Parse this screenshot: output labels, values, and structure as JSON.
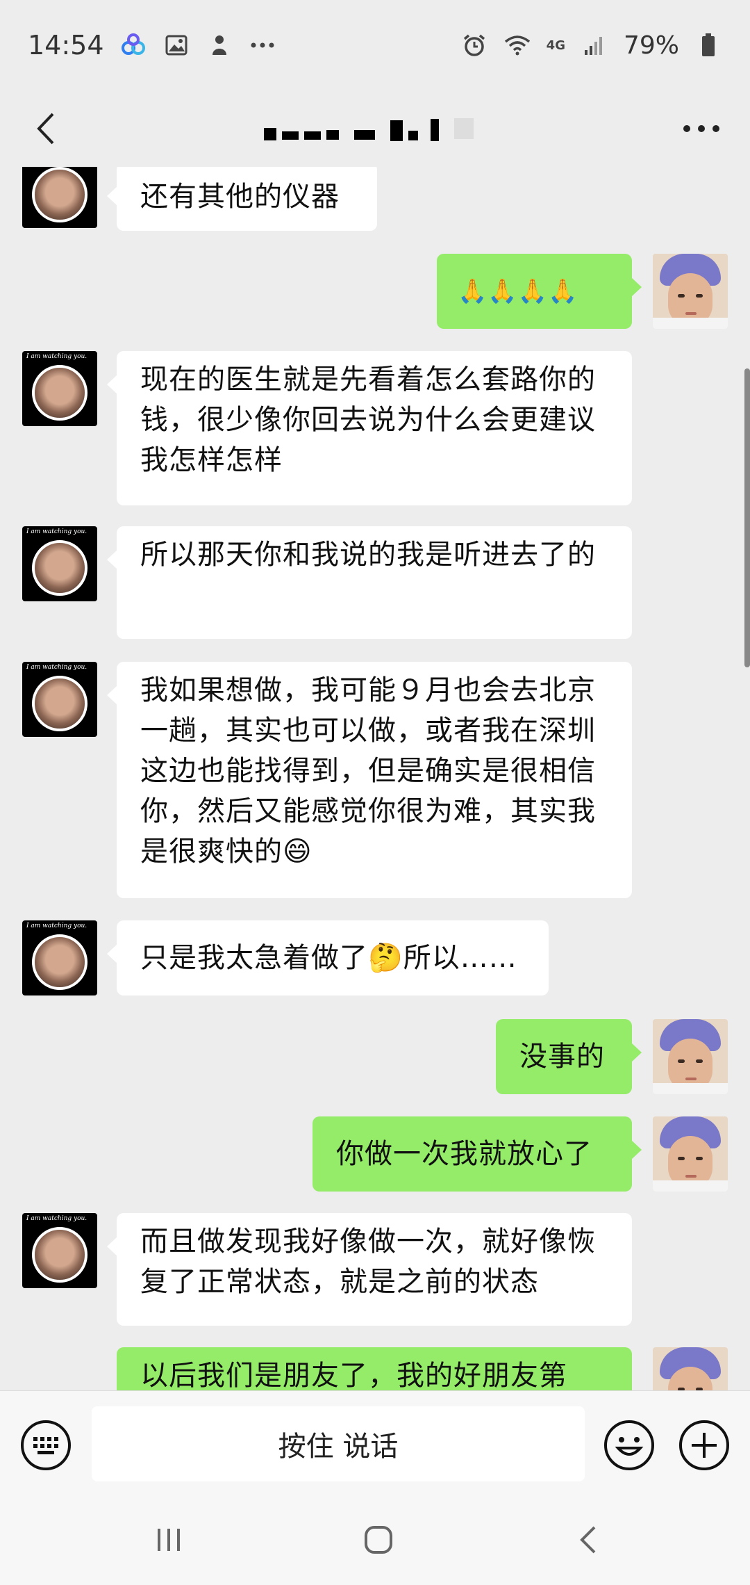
{
  "status_bar": {
    "time": "14:54",
    "network": "4G",
    "battery": "79%",
    "icons": [
      "baidu-cloud-icon",
      "image-icon",
      "notification-icon",
      "more-dots-icon",
      "alarm-icon",
      "wifi-icon",
      "signal-icon",
      "battery-icon"
    ]
  },
  "header": {
    "title_redacted": true,
    "back_icon": "chevron-left-icon",
    "more_icon": "more-horizontal-icon"
  },
  "messages": [
    {
      "side": "left",
      "text": "还有其他的仪器"
    },
    {
      "side": "right",
      "text": "🙏🙏🙏🙏"
    },
    {
      "side": "left",
      "text": "现在的医生就是先看着怎么套路你的钱，很少像你回去说为什么会更建议我怎样怎样"
    },
    {
      "side": "left",
      "text": "所以那天你和我说的我是听进去了的"
    },
    {
      "side": "left",
      "text": "我如果想做，我可能９月也会去北京一趟，其实也可以做，或者我在深圳这边也能找得到，但是确实是很相信你，然后又能感觉你很为难，其实我是很爽快的😄"
    },
    {
      "side": "left",
      "text": "只是我太急着做了🤔所以……"
    },
    {
      "side": "right",
      "text": "没事的"
    },
    {
      "side": "right",
      "text": "你做一次我就放心了"
    },
    {
      "side": "left",
      "text": "而且做发现我好像做一次，就好像恢复了正常状态，就是之前的状态"
    },
    {
      "side": "right",
      "text": "以后我们是朋友了，我的好朋友第"
    }
  ],
  "left_avatar_caption": "I am watching you.",
  "input_bar": {
    "hold_to_talk": "按住 说话"
  },
  "colors": {
    "background": "#ededed",
    "bubble_self": "#95ec69",
    "bubble_other": "#ffffff"
  }
}
